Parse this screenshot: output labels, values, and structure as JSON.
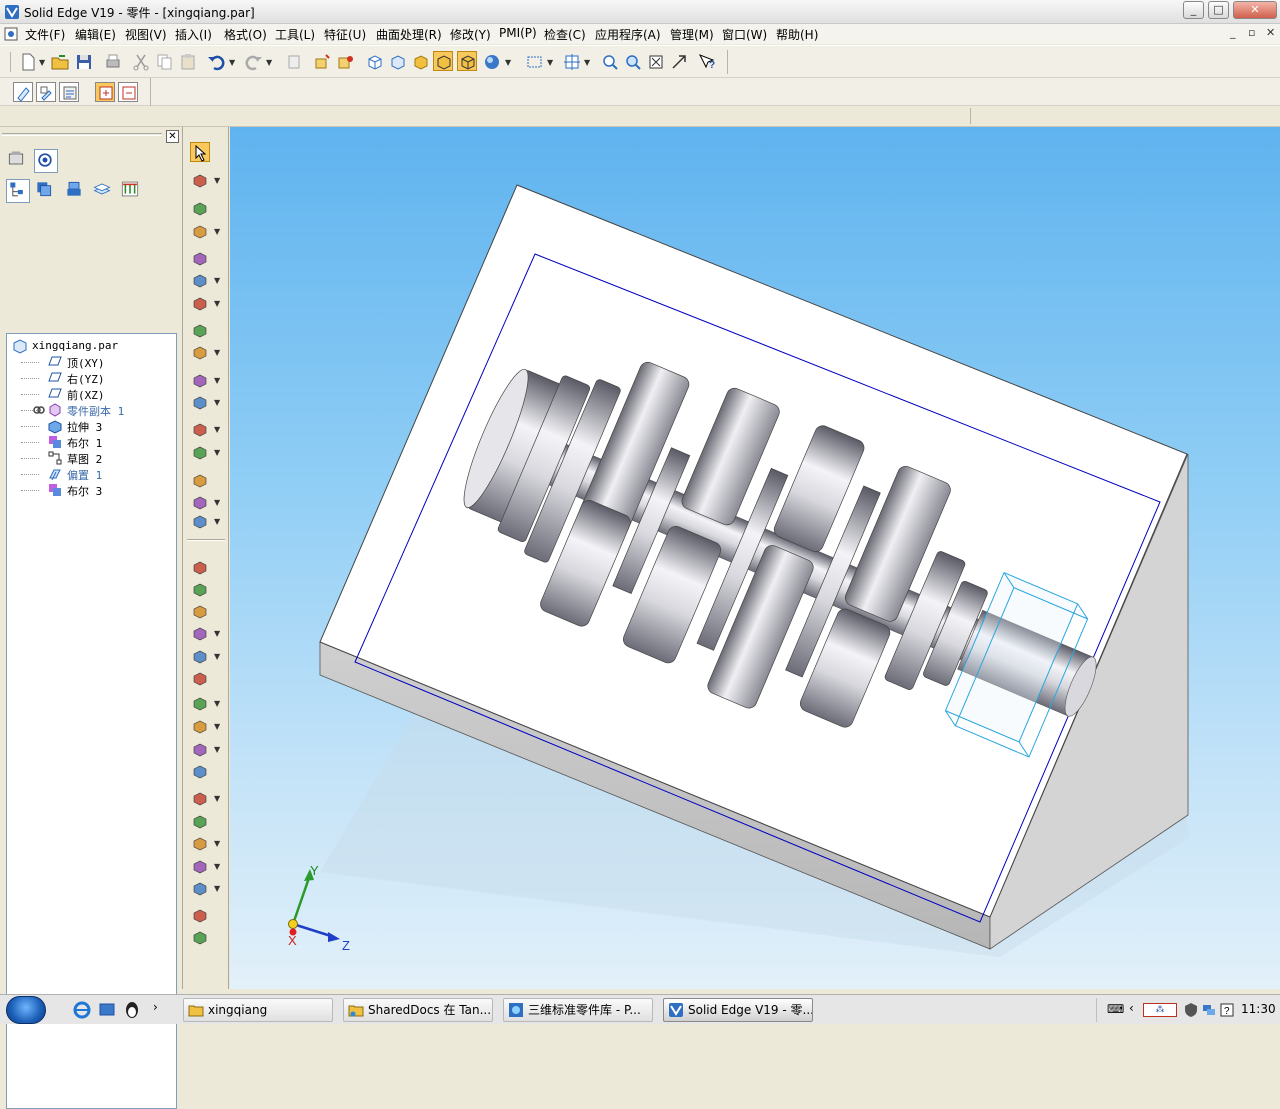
{
  "window": {
    "title": "Solid Edge V19 - 零件 - [xingqiang.par]",
    "controls": [
      "_",
      "□",
      "✕"
    ]
  },
  "menu": {
    "items": [
      "文件(F)",
      "编辑(E)",
      "视图(V)",
      "插入(I)",
      "格式(O)",
      "工具(L)",
      "特征(U)",
      "曲面处理(R)",
      "修改(Y)",
      "PMI(P)",
      "检查(C)",
      "应用程序(A)",
      "管理(M)",
      "窗口(W)",
      "帮助(H)"
    ],
    "mdi_controls": [
      "_",
      "▫",
      "✕"
    ]
  },
  "tree": {
    "root": "xingqiang.par",
    "items": [
      {
        "label": "顶(XY)",
        "icon": "plane-icon",
        "dim": false
      },
      {
        "label": "右(YZ)",
        "icon": "plane-icon",
        "dim": false
      },
      {
        "label": "前(XZ)",
        "icon": "plane-icon",
        "dim": false
      },
      {
        "label": "零件副本 1",
        "icon": "part-copy-icon",
        "dim": true
      },
      {
        "label": "拉伸 3",
        "icon": "extrude-icon",
        "dim": false
      },
      {
        "label": "布尔 1",
        "icon": "boolean-icon",
        "dim": false
      },
      {
        "label": "草图 2",
        "icon": "sketch-icon",
        "dim": false
      },
      {
        "label": "偏置 1",
        "icon": "offset-icon",
        "dim": true
      },
      {
        "label": "布尔 3",
        "icon": "boolean-icon",
        "dim": false
      }
    ]
  },
  "axes": {
    "y": "Y",
    "z": "Z",
    "x": "X"
  },
  "taskbar": {
    "buttons": [
      {
        "label": "xingqiang",
        "icon": "folder-icon"
      },
      {
        "label": "SharedDocs 在 Tan...",
        "icon": "shared-folder-icon"
      },
      {
        "label": "三维标准零件库 - P...",
        "icon": "browser-icon"
      },
      {
        "label": "Solid Edge V19 - 零...",
        "icon": "solid-edge-icon"
      }
    ],
    "clock": "11:30"
  },
  "colors": {
    "viewport_top": "#5fb3ef",
    "viewport_bottom": "#e2f0f9",
    "sketch_line": "#0000c0",
    "reference_plane": "#2aa6e0"
  }
}
